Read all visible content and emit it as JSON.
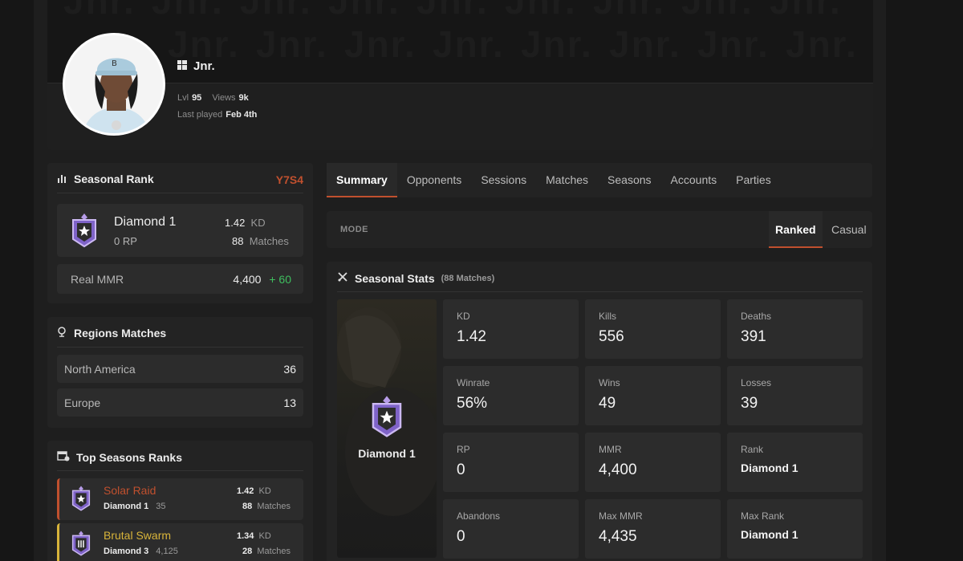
{
  "profile": {
    "name": "Jnr.",
    "level_label": "Lvl",
    "level": "95",
    "views_label": "Views",
    "views": "9k",
    "last_played_label": "Last played",
    "last_played": "Feb 4th",
    "banner_text": "Jnr.",
    "platform_icon": "windows-icon"
  },
  "seasonal_rank": {
    "title": "Seasonal Rank",
    "season": "Y7S4",
    "rank": "Diamond 1",
    "rp": "0 RP",
    "kd_value": "1.42",
    "kd_label": "KD",
    "matches_value": "88",
    "matches_label": "Matches",
    "real_mmr_label": "Real MMR",
    "real_mmr": "4,400",
    "mmr_change": "+ 60"
  },
  "regions": {
    "title": "Regions Matches",
    "items": [
      {
        "name": "North America",
        "count": "36"
      },
      {
        "name": "Europe",
        "count": "13"
      }
    ]
  },
  "top_seasons": {
    "title": "Top Seasons Ranks",
    "items": [
      {
        "season": "Solar Raid",
        "rank": "Diamond 1",
        "mmr": "35",
        "kd": "1.42",
        "kd_label": "KD",
        "matches": "88",
        "matches_label": "Matches",
        "color": "#c0502e"
      },
      {
        "season": "Brutal Swarm",
        "rank": "Diamond 3",
        "mmr": "4,125",
        "kd": "1.34",
        "kd_label": "KD",
        "matches": "28",
        "matches_label": "Matches",
        "color": "#d8b43a"
      }
    ]
  },
  "tabs": [
    "Summary",
    "Opponents",
    "Sessions",
    "Matches",
    "Seasons",
    "Accounts",
    "Parties"
  ],
  "mode": {
    "label": "MODE",
    "options": [
      "Ranked",
      "Casual"
    ],
    "selected": "Ranked"
  },
  "seasonal_stats": {
    "title": "Seasonal Stats",
    "matches_note": "(88 Matches)",
    "rank_name": "Diamond 1",
    "stats": [
      {
        "label": "KD",
        "value": "1.42"
      },
      {
        "label": "Kills",
        "value": "556"
      },
      {
        "label": "Deaths",
        "value": "391"
      },
      {
        "label": "Winrate",
        "value": "56%"
      },
      {
        "label": "Wins",
        "value": "49"
      },
      {
        "label": "Losses",
        "value": "39"
      },
      {
        "label": "RP",
        "value": "0"
      },
      {
        "label": "MMR",
        "value": "4,400"
      },
      {
        "label": "Rank",
        "value": "Diamond 1"
      },
      {
        "label": "Abandons",
        "value": "0"
      },
      {
        "label": "Max MMR",
        "value": "4,435"
      },
      {
        "label": "Max Rank",
        "value": "Diamond 1"
      }
    ]
  },
  "colors": {
    "accent": "#c0502e",
    "positive": "#3fbf5f",
    "diamond": "#8d72d6"
  }
}
